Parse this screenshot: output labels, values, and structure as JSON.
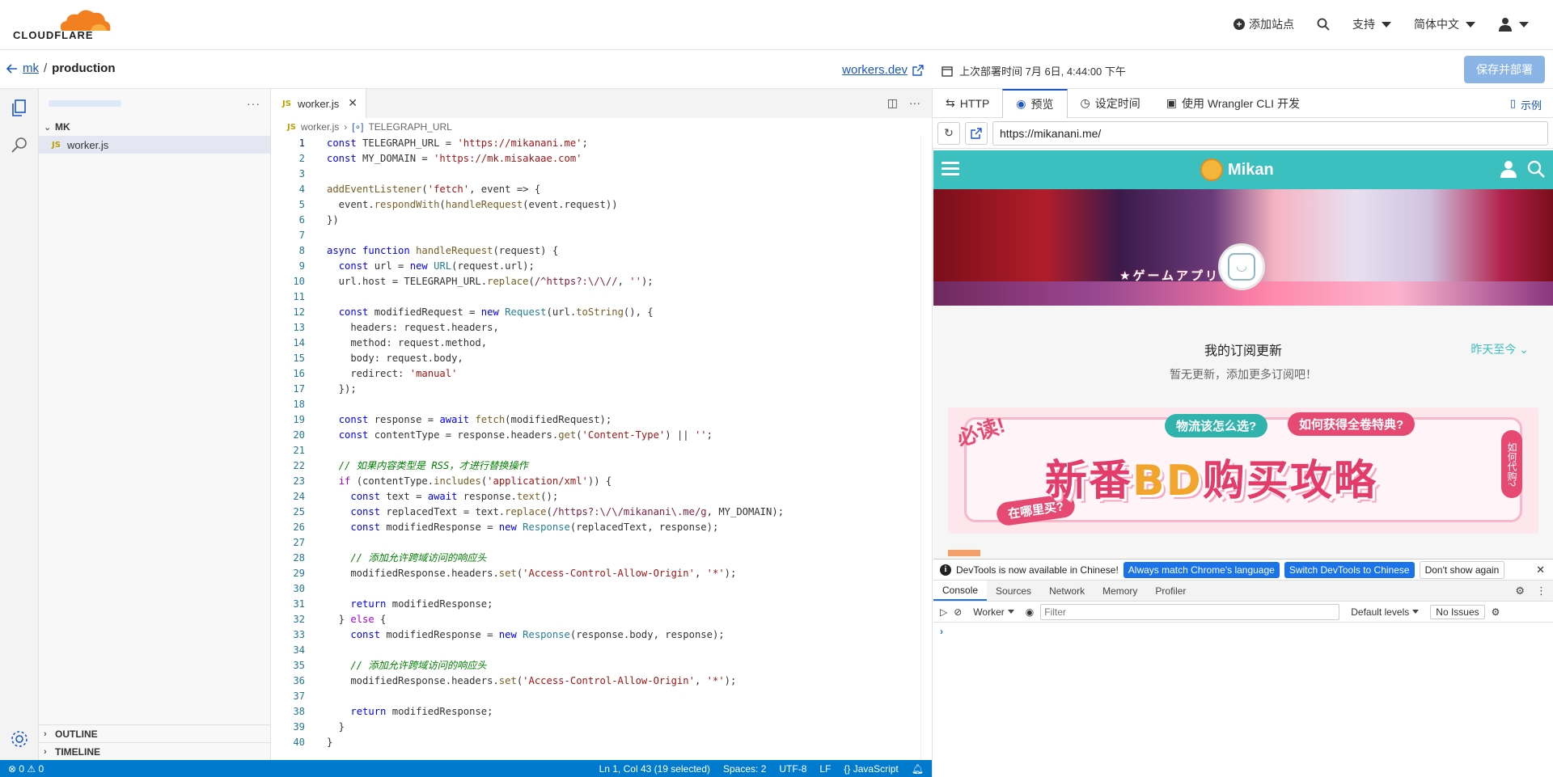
{
  "topnav": {
    "logo_text": "CLOUDFLARE",
    "add_site": "添加站点",
    "support": "支持",
    "language": "简体中文"
  },
  "breadcrumb": {
    "account": "mk",
    "separator": "/",
    "current": "production",
    "workers_link": "workers.dev"
  },
  "right_header": {
    "deploy_time": "上次部署时间 7月 6日, 4:44:00 下午",
    "save_button": "保存并部署"
  },
  "explorer": {
    "folder": "MK",
    "file": "worker.js",
    "outline": "OUTLINE",
    "timeline": "TIMELINE"
  },
  "editor": {
    "tab_label": "worker.js",
    "breadcrumb_file": "worker.js",
    "breadcrumb_symbol": "TELEGRAPH_URL",
    "lines": [
      "const TELEGRAPH_URL = 'https://mikanani.me';",
      "const MY_DOMAIN = 'https://mk.misakaae.com'",
      "",
      "addEventListener('fetch', event => {",
      "  event.respondWith(handleRequest(event.request))",
      "})",
      "",
      "async function handleRequest(request) {",
      "  const url = new URL(request.url);",
      "  url.host = TELEGRAPH_URL.replace(/^https?:\\/\\//, '');",
      "",
      "  const modifiedRequest = new Request(url.toString(), {",
      "    headers: request.headers,",
      "    method: request.method,",
      "    body: request.body,",
      "    redirect: 'manual'",
      "  });",
      "",
      "  const response = await fetch(modifiedRequest);",
      "  const contentType = response.headers.get('Content-Type') || '';",
      "",
      "  // 如果内容类型是 RSS，才进行替换操作",
      "  if (contentType.includes('application/xml')) {",
      "    const text = await response.text();",
      "    const replacedText = text.replace(/https?:\\/\\/mikanani\\.me/g, MY_DOMAIN);",
      "    const modifiedResponse = new Response(replacedText, response);",
      "",
      "    // 添加允许跨域访问的响应头",
      "    modifiedResponse.headers.set('Access-Control-Allow-Origin', '*');",
      "",
      "    return modifiedResponse;",
      "  } else {",
      "    const modifiedResponse = new Response(response.body, response);",
      "",
      "    // 添加允许跨域访问的响应头",
      "    modifiedResponse.headers.set('Access-Control-Allow-Origin', '*');",
      "",
      "    return modifiedResponse;",
      "  }",
      "}"
    ]
  },
  "statusbar": {
    "problems": "⊗ 0 ⚠ 0",
    "position": "Ln 1, Col 43 (19 selected)",
    "spaces": "Spaces: 2",
    "encoding": "UTF-8",
    "eol": "LF",
    "language": "{} JavaScript"
  },
  "right_tabs": {
    "http": "HTTP",
    "preview": "预览",
    "schedule": "设定时间",
    "wrangler": "使用 Wrangler CLI 开发",
    "example": "示例"
  },
  "preview": {
    "url": "https://mikanani.me/",
    "site_name": "Mikan",
    "banner_text": "★ゲームアプリ★",
    "subs_title": "我的订阅更新",
    "subs_range": "昨天至今",
    "subs_empty": "暂无更新，添加更多订阅吧！",
    "ad_text_a": "新番",
    "ad_text_b": "BD",
    "ad_text_c": "购买攻略",
    "ad_pill_1": "物流该怎么选?",
    "ad_pill_2": "如何获得全卷特典?",
    "ad_pill_3": "在哪里买?",
    "ad_corner": "必读!",
    "ad_side": "如何代购?"
  },
  "devtools": {
    "notice": "DevTools is now available in Chinese!",
    "btn_match": "Always match Chrome's language",
    "btn_switch": "Switch DevTools to Chinese",
    "btn_dont": "Don't show again",
    "tabs": [
      "Console",
      "Sources",
      "Network",
      "Memory",
      "Profiler"
    ],
    "context": "Worker",
    "filter_placeholder": "Filter",
    "levels": "Default levels",
    "issues": "No Issues",
    "prompt": "›"
  },
  "colors": {
    "accent": "#1a56c4",
    "statusbar": "#007acc",
    "mikan_teal": "#3bbfbf",
    "save_button": "#8bb4e6"
  }
}
